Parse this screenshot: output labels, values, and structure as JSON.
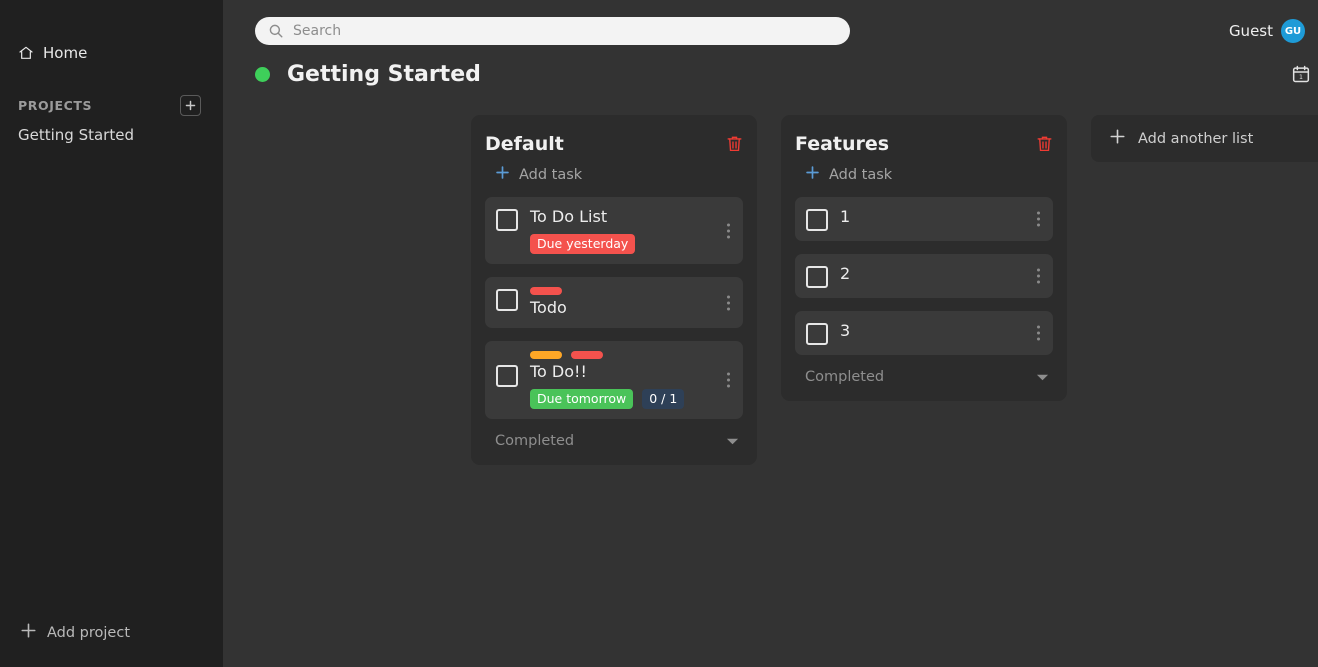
{
  "colors": {
    "page_bg": "#333333",
    "sidebar_bg": "#202020",
    "column_bg": "#2c2c2c",
    "card_bg": "#3a3a3a",
    "accent_blue": "#4a90d9",
    "avatar_blue": "#1e9bd7",
    "status_green": "#3ecf5a",
    "danger_red": "#f4524d",
    "label_orange": "#ffa726",
    "badge_green": "#4ac359",
    "badge_navy": "#2e4057"
  },
  "sidebar": {
    "home": {
      "label": "Home",
      "icon": "home-icon"
    },
    "projects_header": "PROJECTS",
    "add_project_icon": "plus-box-icon",
    "projects": [
      {
        "label": "Getting Started"
      }
    ],
    "add_project": {
      "label": "Add project",
      "icon": "plus-icon"
    }
  },
  "topbar": {
    "search": {
      "placeholder": "Search",
      "value": "",
      "icon": "search-icon"
    },
    "user": {
      "name": "Guest",
      "initials": "GU"
    }
  },
  "board_header": {
    "status_dot": "green",
    "title": "Getting Started",
    "calendar_icon": "calendar-icon",
    "calendar_day": "1"
  },
  "columns": [
    {
      "title": "Default",
      "delete_icon": "trash-icon",
      "add_task_label": "Add task",
      "completed_label": "Completed",
      "tasks": [
        {
          "title": "To Do List",
          "checked": false,
          "labels": [],
          "badges": [
            {
              "text": "Due yesterday",
              "color": "#f4524d"
            }
          ]
        },
        {
          "title": "Todo",
          "checked": false,
          "labels": [
            "#f4524d"
          ],
          "badges": []
        },
        {
          "title": "To Do!!",
          "checked": false,
          "labels": [
            "#ffa726",
            "#f4524d"
          ],
          "badges": [
            {
              "text": "Due tomorrow",
              "color": "#4ac359"
            },
            {
              "text": "0 / 1",
              "color": "#2e4057"
            }
          ]
        }
      ]
    },
    {
      "title": "Features",
      "delete_icon": "trash-icon",
      "add_task_label": "Add task",
      "completed_label": "Completed",
      "tasks": [
        {
          "title": "1",
          "checked": false,
          "labels": [],
          "badges": []
        },
        {
          "title": "2",
          "checked": false,
          "labels": [],
          "badges": []
        },
        {
          "title": "3",
          "checked": false,
          "labels": [],
          "badges": []
        }
      ]
    }
  ],
  "add_list": {
    "label": "Add another list",
    "icon": "plus-icon"
  }
}
